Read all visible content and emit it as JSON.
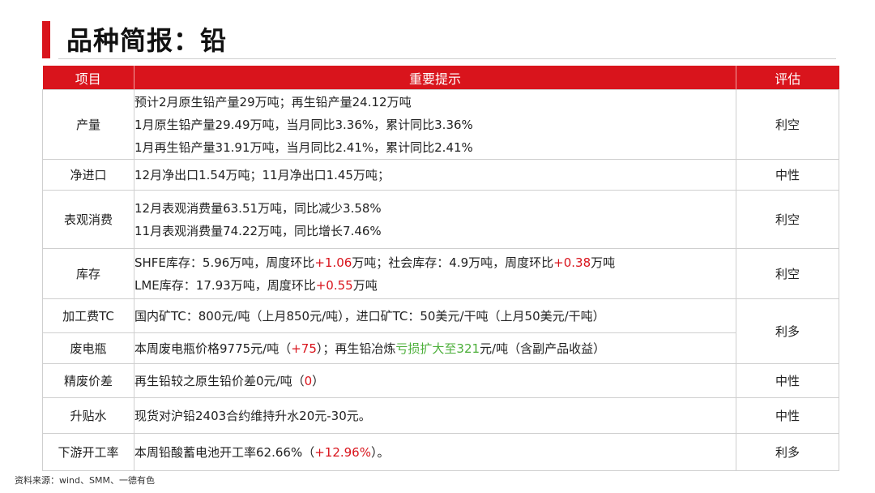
{
  "page": {
    "title": "品种简报：铅",
    "source": "资料来源：wind、SMM、一德有色"
  },
  "table": {
    "headers": [
      "项目",
      "重要提示",
      "评估"
    ],
    "rows": [
      {
        "item": "产量",
        "lines": [
          [
            {
              "text": "预计2月原生铅产量29万吨；再生铅产量24.12万吨",
              "color": "normal"
            }
          ],
          [
            {
              "text": "1月原生铅产量29.49万吨，当月同比3.36%，累计同比3.36%",
              "color": "normal"
            }
          ],
          [
            {
              "text": "1月再生铅产量31.91万吨，当月同比2.41%，累计同比2.41%",
              "color": "normal"
            }
          ]
        ],
        "eval": "利空"
      },
      {
        "item": "净进口",
        "lines": [
          [
            {
              "text": "12月净出口1.54万吨；11月净出口1.45万吨；",
              "color": "normal"
            }
          ]
        ],
        "eval": "中性"
      },
      {
        "item": "表观消费",
        "lines": [
          [
            {
              "text": "12月表观消费量63.51万吨，同比减少3.58%",
              "color": "normal"
            }
          ],
          [
            {
              "text": "11月表观消费量74.22万吨，同比增长7.46%",
              "color": "normal"
            }
          ]
        ],
        "eval": "利空"
      },
      {
        "item": "库存",
        "lines": [
          [
            {
              "text": "SHFE库存：5.96万吨，周度环比",
              "color": "normal"
            },
            {
              "text": "+1.06",
              "color": "red"
            },
            {
              "text": "万吨；社会库存：4.9万吨，周度环比",
              "color": "normal"
            },
            {
              "text": "+0.38",
              "color": "red"
            },
            {
              "text": "万吨",
              "color": "normal"
            }
          ],
          [
            {
              "text": "LME库存：17.93万吨，周度环比",
              "color": "normal"
            },
            {
              "text": "+0.55",
              "color": "red"
            },
            {
              "text": "万吨",
              "color": "normal"
            }
          ]
        ],
        "eval": "利空"
      },
      {
        "item": "加工费TC",
        "lines": [
          [
            {
              "text": "国内矿TC：800元/吨（上月850元/吨），进口矿TC：50美元/干吨（上月50美元/干吨）",
              "color": "normal"
            }
          ]
        ],
        "eval": "利多"
      },
      {
        "item": "废电瓶",
        "lines": [
          [
            {
              "text": "本周废电瓶价格9775元/吨（",
              "color": "normal"
            },
            {
              "text": "+75",
              "color": "red"
            },
            {
              "text": "）；再生铅冶炼",
              "color": "normal"
            },
            {
              "text": "亏损扩大至321",
              "color": "green"
            },
            {
              "text": "元/吨（含副产品收益）",
              "color": "normal"
            }
          ]
        ]
      },
      {
        "item": "精废价差",
        "lines": [
          [
            {
              "text": "再生铅较之原生铅价差0元/吨（",
              "color": "normal"
            },
            {
              "text": "0",
              "color": "red"
            },
            {
              "text": "）",
              "color": "normal"
            }
          ]
        ],
        "eval": "中性"
      },
      {
        "item": "升贴水",
        "lines": [
          [
            {
              "text": "现货对沪铅2403合约维持升水20元-30元。",
              "color": "normal"
            }
          ]
        ],
        "eval": "中性"
      },
      {
        "item": "下游开工率",
        "lines": [
          [
            {
              "text": "本周铅酸蓄电池开工率62.66%（",
              "color": "normal"
            },
            {
              "text": "+12.96%",
              "color": "red"
            },
            {
              "text": "）。",
              "color": "normal"
            }
          ]
        ],
        "eval": "利多"
      }
    ]
  },
  "colors": {
    "accent": "#d9141c",
    "positive": "#d9141c",
    "negative": "#4caf3a"
  }
}
